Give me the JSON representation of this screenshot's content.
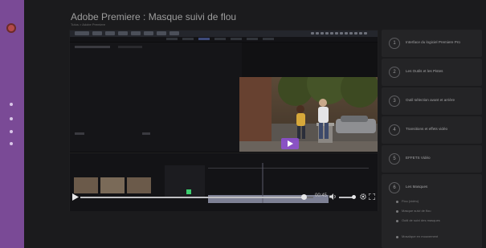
{
  "page": {
    "title": "Adobe Premiere : Masque suivi de flou",
    "breadcrumb": "Tutos > Adobe Premiere"
  },
  "right_panel": {
    "steps": [
      {
        "num": "1",
        "label": "Interface du logiciel Premiere Pro"
      },
      {
        "num": "2",
        "label": "Les Outils et les Pistes"
      },
      {
        "num": "3",
        "label": "Outil sélection avant et arrière"
      },
      {
        "num": "4",
        "label": "Transitions et effets vidéo"
      },
      {
        "num": "5",
        "label": "EFFETS Vidéo"
      },
      {
        "num": "6",
        "label": "Les Masques"
      }
    ],
    "sub_items": [
      "Flou (vidéo)",
      "Masque suivi de flou",
      "Outil de suivi des masques",
      "Mosaïque en mouvement"
    ]
  },
  "controls": {
    "time": "00:45",
    "progress": 0.96
  },
  "colors": {
    "accent": "#7a4a96",
    "background": "#1b1b1d",
    "card": "#242426"
  },
  "icons": [
    "play-icon",
    "volume-icon",
    "settings-icon",
    "fullscreen-icon"
  ]
}
